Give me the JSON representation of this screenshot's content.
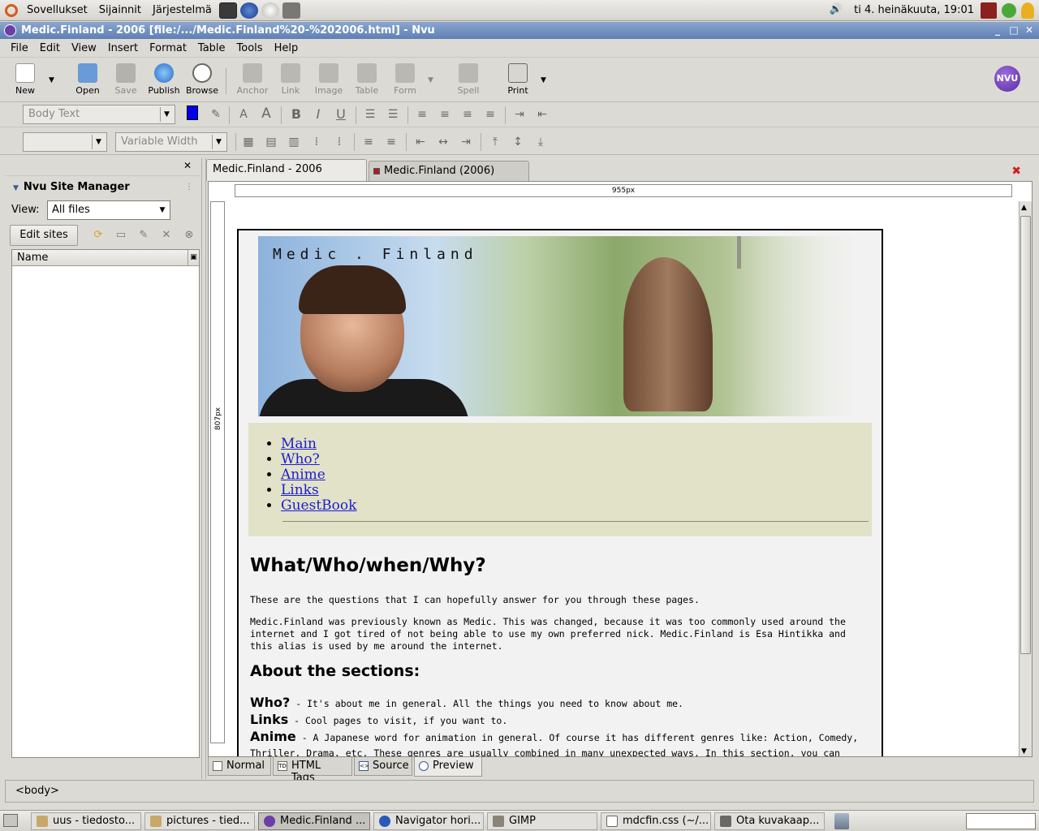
{
  "top_panel": {
    "menus": [
      "Sovellukset",
      "Sijainnit",
      "Järjestelmä"
    ],
    "clock": "ti  4. heinäkuuta, 19:01"
  },
  "window": {
    "title": "Medic.Finland - 2006 [file:/.../Medic.Finland%20-%202006.html] - Nvu"
  },
  "menubar": [
    "File",
    "Edit",
    "View",
    "Insert",
    "Format",
    "Table",
    "Tools",
    "Help"
  ],
  "toolbar": {
    "buttons": [
      {
        "label": "New",
        "icon": "new-page-icon",
        "enabled": true
      },
      {
        "label": "Open",
        "icon": "open-folder-icon",
        "enabled": true
      },
      {
        "label": "Save",
        "icon": "save-disk-icon",
        "enabled": false
      },
      {
        "label": "Publish",
        "icon": "globe-icon",
        "enabled": true
      },
      {
        "label": "Browse",
        "icon": "magnifier-icon",
        "enabled": true
      },
      {
        "label": "Anchor",
        "icon": "anchor-icon",
        "enabled": false
      },
      {
        "label": "Link",
        "icon": "chain-link-icon",
        "enabled": false
      },
      {
        "label": "Image",
        "icon": "image-icon",
        "enabled": false
      },
      {
        "label": "Table",
        "icon": "table-icon",
        "enabled": false
      },
      {
        "label": "Form",
        "icon": "form-icon",
        "enabled": false
      },
      {
        "label": "Spell",
        "icon": "spellcheck-icon",
        "enabled": false
      },
      {
        "label": "Print",
        "icon": "printer-icon",
        "enabled": true
      }
    ],
    "logo_text": "NVU"
  },
  "format": {
    "paragraph_style": "Body Text",
    "font": "Variable Width"
  },
  "site_manager": {
    "title": "Nvu Site Manager",
    "view_label": "View:",
    "view_value": "All files",
    "edit_sites_label": "Edit sites",
    "column_name": "Name"
  },
  "tabs": [
    {
      "label": "Medic.Finland - 2006",
      "active": true
    },
    {
      "label": "Medic.Finland (2006)",
      "active": false
    }
  ],
  "editor": {
    "width_ruler": "955px",
    "height_ruler": "807px"
  },
  "page": {
    "banner_title": "Medic . Finland",
    "nav_links": [
      "Main",
      "Who?",
      "Anime",
      "Links",
      "GuestBook"
    ],
    "heading": "What/Who/when/Why?",
    "para1": "These are the questions that I can hopefully answer for you through these pages.",
    "para2": "Medic.Finland was previously known as Medic. This was changed, because it was too commonly used around the internet and I got tired of not being able to use my own preferred nick. Medic.Finland is Esa Hintikka and this alias is used by me around the internet.",
    "sections_heading": "About the sections:",
    "sections": [
      {
        "name": "Who?",
        "text": " - It's about me in general. All the things you need to know about me."
      },
      {
        "name": "Links",
        "text": " - Cool pages to visit, if you want to."
      },
      {
        "name": "Anime",
        "text": " - A Japanese word for animation in general. Of course it has different genres like: Action, Comedy,"
      }
    ],
    "cut_line": "Thriller, Drama, etc. These genres are usually combined in many unexpected ways. In this section, you can"
  },
  "modes": [
    "Normal",
    "HTML Tags",
    "Source",
    "Preview"
  ],
  "status": "<body>",
  "taskbar": [
    {
      "label": "uus - tiedosto...",
      "active": false
    },
    {
      "label": "pictures - tied...",
      "active": false
    },
    {
      "label": "Medic.Finland ...",
      "active": true
    },
    {
      "label": "Navigator hori...",
      "active": false
    },
    {
      "label": "GIMP",
      "active": false
    },
    {
      "label": "mdcfin.css (~/...",
      "active": false
    },
    {
      "label": "Ota kuvakaap...",
      "active": false
    }
  ]
}
